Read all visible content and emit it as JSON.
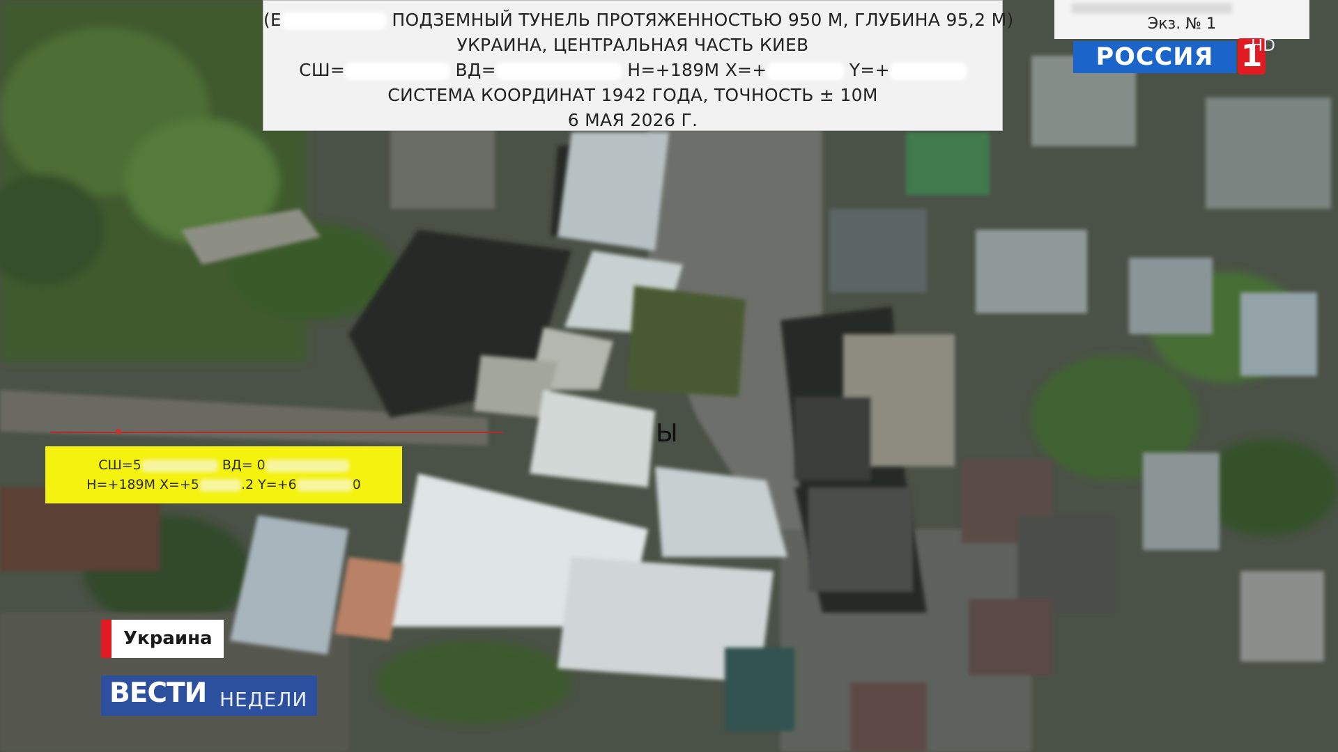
{
  "header": {
    "line1_a": "(Е",
    "line1_b": "ПОДЗЕМНЫЙ ТУНЕЛЬ ПРОТЯЖЕННОСТЬЮ 950 М, ГЛУБИНА 95,2 М)",
    "line2": "УКРАИНА, ЦЕНТРАЛЬНАЯ ЧАСТЬ КИЕВ",
    "line3_a": "СШ=",
    "line3_b": "ВД=",
    "line3_c": "Н=+189М Х=+",
    "line3_d": "Y=+",
    "line4": "СИСТЕМА КООРДИНАТ 1942 ГОДА, ТОЧНОСТЬ ± 10М",
    "line5": "6 МАЯ 2026 Г."
  },
  "copy_label": "Экз. № 1",
  "channel": {
    "name": "РОССИЯ",
    "number": "1",
    "quality": "HD"
  },
  "coords_box": {
    "line1_a": "СШ=5",
    "line1_b": "ВД= 0",
    "line2_a": "Н=+189М Х=+5",
    "line2_b": ".2 Y=+6",
    "line2_c": "0"
  },
  "map_letter": "Ы",
  "location_tag": "Украина",
  "program": {
    "main": "ВЕСТИ",
    "sub": "НЕДЕЛИ"
  },
  "colors": {
    "coords_box": "#f4f20f",
    "channel_blue": "#1b64c9",
    "channel_red": "#e11b22",
    "program_blue": "#2c4f9e",
    "pointer_line": "#b52a2a"
  }
}
